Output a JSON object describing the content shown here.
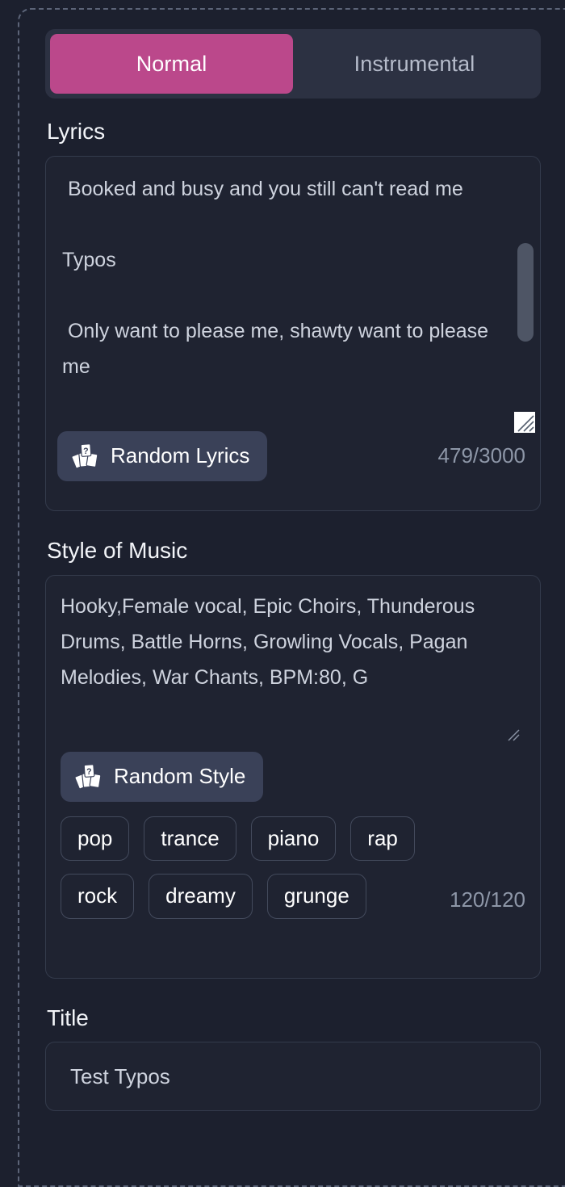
{
  "mode_tabs": {
    "active_color": "#bb488b",
    "items": [
      {
        "label": "Normal",
        "active": true
      },
      {
        "label": "Instrumental",
        "active": false
      }
    ]
  },
  "lyrics_section": {
    "label": "Lyrics",
    "value": " Booked and busy and you still can't read me\n\nTypos\n\n Only want to please me, shawty want to please me",
    "placeholder": "Enter your own lyrics",
    "random_button": {
      "label": "Random Lyrics",
      "icon": "shuffle-cards-icon"
    },
    "counter": "479/3000"
  },
  "style_section": {
    "label": "Style of Music",
    "value": "Hooky,Female vocal, Epic Choirs, Thunderous Drums, Battle Horns, Growling Vocals, Pagan Melodies, War Chants, BPM:80, G",
    "placeholder": "Enter style of music",
    "random_button": {
      "label": "Random Style",
      "icon": "shuffle-cards-icon"
    },
    "tags": [
      "pop",
      "trance",
      "piano",
      "rap",
      "rock",
      "dreamy",
      "grunge"
    ],
    "counter": "120/120"
  },
  "title_section": {
    "label": "Title",
    "value": "Test Typos",
    "placeholder": "Enter a title"
  },
  "colors": {
    "background": "#1c202e",
    "card_background": "#1f2331",
    "card_border": "#343b4c",
    "accent_pink": "#bb488b",
    "tab_track": "#2c3142",
    "button_background": "#3a4158",
    "muted_text": "#8e97a8",
    "dashed_frame": "#5c6478"
  }
}
